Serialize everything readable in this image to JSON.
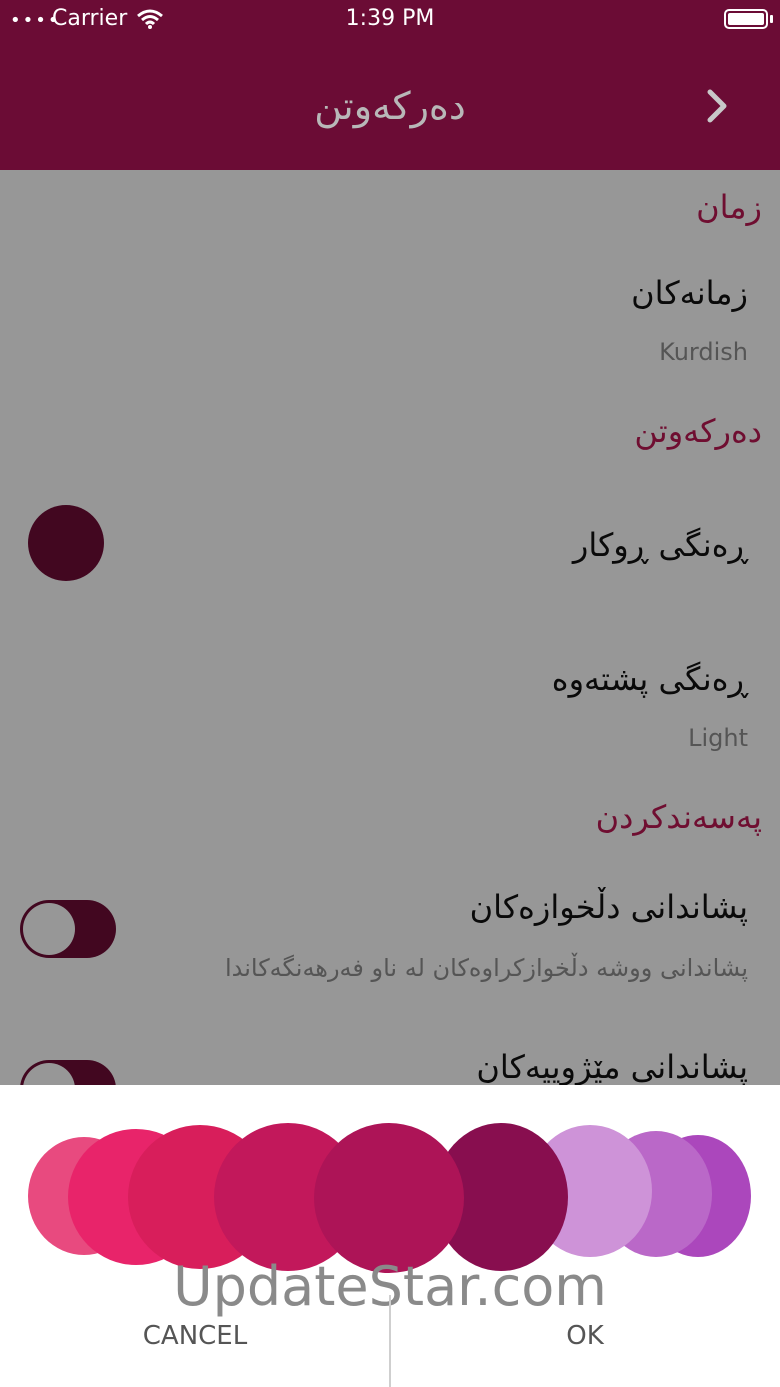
{
  "status_bar": {
    "carrier": "Carrier",
    "time": "1:39 PM"
  },
  "nav": {
    "title": "دەرکەوتن"
  },
  "settings": {
    "sections": [
      {
        "header": "زمان",
        "rows": [
          {
            "title": "زمانەکان",
            "value": "Kurdish"
          }
        ]
      },
      {
        "header": "دەرکەوتن",
        "rows": [
          {
            "title": "ڕەنگی ڕوکار",
            "accessory": "color-dot"
          },
          {
            "title": "ڕەنگی پشتەوە",
            "value": "Light"
          }
        ]
      },
      {
        "header": "پەسەندکردن",
        "rows": [
          {
            "title": "پشاندانی دڵخوازەکان",
            "subtitle": "پشاندانی ووشە دڵخوازکراوەکان لە ناو فەرهەنگەکاندا",
            "toggle": true
          },
          {
            "title": "پشاندانی مێژوییەکان",
            "toggle": true
          }
        ]
      }
    ]
  },
  "color_picker": {
    "swatches": [
      "#e84a7f",
      "#e8246a",
      "#d81e5b",
      "#c2185b",
      "#ad1457",
      "#880e4f",
      "#ce93d8",
      "#ba68c8",
      "#ab47bc"
    ],
    "selected": "#ad1457",
    "cancel_label": "CANCEL",
    "ok_label": "OK"
  },
  "watermark": "UpdateStar.com",
  "colors": {
    "primary": "#6b0c35",
    "accent": "#b3174f"
  }
}
